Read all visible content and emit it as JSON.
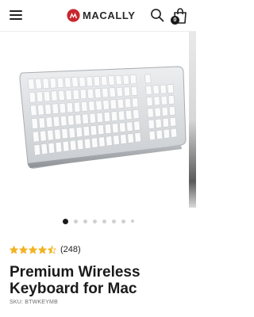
{
  "header": {
    "brand": "MACALLY",
    "cart_count": "0"
  },
  "colors": {
    "brand_red": "#c8272d",
    "star_gold": "#f0b323",
    "text_dark": "#1a1a1a",
    "dot_active": "#1a1a1a",
    "dot_inactive": "#d0d0d0"
  },
  "icons": [
    "menu-icon",
    "brand-logo-icon",
    "search-icon",
    "cart-icon",
    "star-icon"
  ],
  "gallery": {
    "image_count": 8,
    "active_index": 0
  },
  "product": {
    "rating_value": 4.5,
    "rating_count": "(248)",
    "title": "Premium Wireless Keyboard for Mac",
    "sku": "SKU: BTWKEYMB"
  }
}
